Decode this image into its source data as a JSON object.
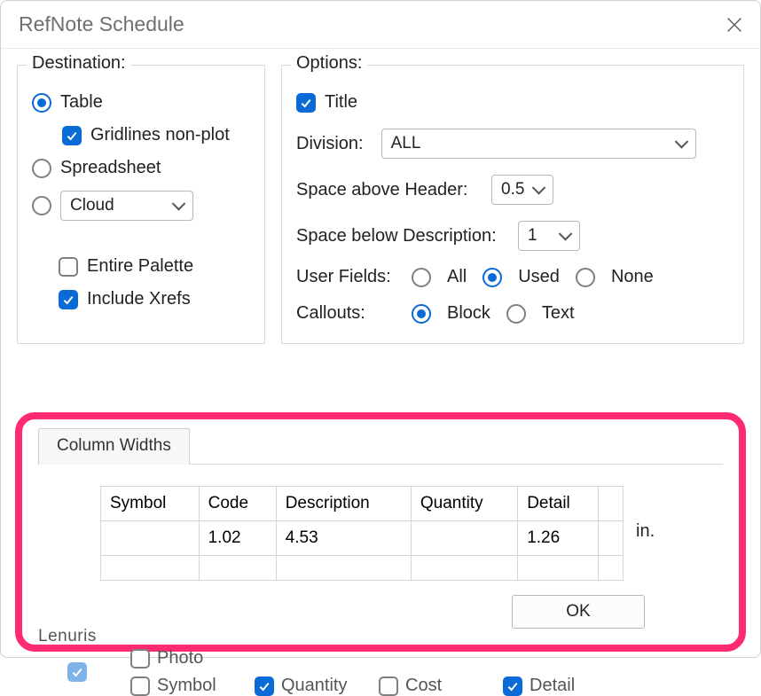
{
  "window": {
    "title": "RefNote Schedule"
  },
  "destination": {
    "legend": "Destination:",
    "table": "Table",
    "gridlines": "Gridlines non-plot",
    "spreadsheet": "Spreadsheet",
    "cloud_selected": "Cloud",
    "entire_palette": "Entire Palette",
    "include_xrefs": "Include Xrefs"
  },
  "options": {
    "legend": "Options:",
    "title": "Title",
    "division_label": "Division:",
    "division_value": "ALL",
    "space_above_label": "Space above Header:",
    "space_above_value": "0.5",
    "space_below_label": "Space below Description:",
    "space_below_value": "1",
    "user_fields_label": "User Fields:",
    "uf_all": "All",
    "uf_used": "Used",
    "uf_none": "None",
    "callouts_label": "Callouts:",
    "co_block": "Block",
    "co_text": "Text"
  },
  "column_widths": {
    "tab": "Column Widths",
    "headers": [
      "Symbol",
      "Code",
      "Description",
      "Quantity",
      "Detail"
    ],
    "values": [
      "",
      "1.02",
      "4.53",
      "",
      "1.26"
    ],
    "unit": "in.",
    "ok": "OK"
  },
  "peek": {
    "legend": "Lenuris",
    "photo": "Photo",
    "symbol": "Symbol",
    "quantity": "Quantity",
    "cost": "Cost",
    "detail": "Detail"
  }
}
